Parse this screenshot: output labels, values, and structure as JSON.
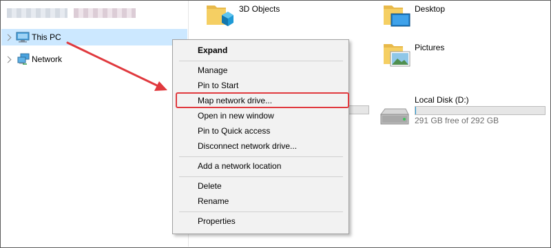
{
  "nav": {
    "items": [
      {
        "label": "This PC",
        "icon": "computer-icon",
        "selected": true
      },
      {
        "label": "Network",
        "icon": "network-icon",
        "selected": false
      }
    ]
  },
  "content": {
    "folders": [
      {
        "label": "3D Objects",
        "icon": "3d-objects-folder-icon"
      },
      {
        "label": "Desktop",
        "icon": "desktop-folder-icon"
      },
      {
        "label": "Pictures",
        "icon": "pictures-folder-icon"
      }
    ],
    "drives": [
      {
        "label": "Local Disk (D:)",
        "free_text": "291 GB free of 292 GB",
        "used_fraction": 0.003,
        "icon": "hard-disk-icon"
      }
    ]
  },
  "context_menu": {
    "items": [
      {
        "label": "Expand",
        "bold": true
      },
      {
        "label": "Manage"
      },
      {
        "label": "Pin to Start"
      },
      {
        "label": "Map network drive...",
        "highlighted": true
      },
      {
        "label": "Open in new window"
      },
      {
        "label": "Pin to Quick access"
      },
      {
        "label": "Disconnect network drive..."
      },
      {
        "label": "Add a network location"
      },
      {
        "label": "Delete"
      },
      {
        "label": "Rename"
      },
      {
        "label": "Properties"
      }
    ]
  },
  "colors": {
    "selection": "#cce8ff",
    "menu_background": "#f2f2f2",
    "annotation_red": "#e0393e",
    "progress_blue": "#26a0da"
  }
}
